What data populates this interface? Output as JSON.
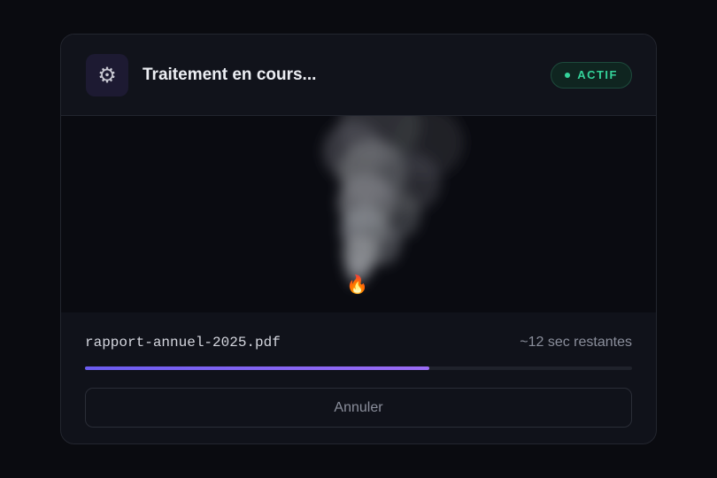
{
  "header": {
    "icon": "gear-icon",
    "title": "Traitement en cours...",
    "status_badge": "ACTIF"
  },
  "stage": {
    "flame_icon": "flame-icon",
    "smoke": "smoke-plume"
  },
  "task": {
    "filename": "rapport-annuel-2025.pdf",
    "remaining": "~12 sec restantes",
    "progress": 0.63
  },
  "actions": {
    "cancel_label": "Annuler"
  },
  "colors": {
    "accent": "#7c5cf2",
    "status": "#34d39a",
    "background": "#0a0b10"
  }
}
